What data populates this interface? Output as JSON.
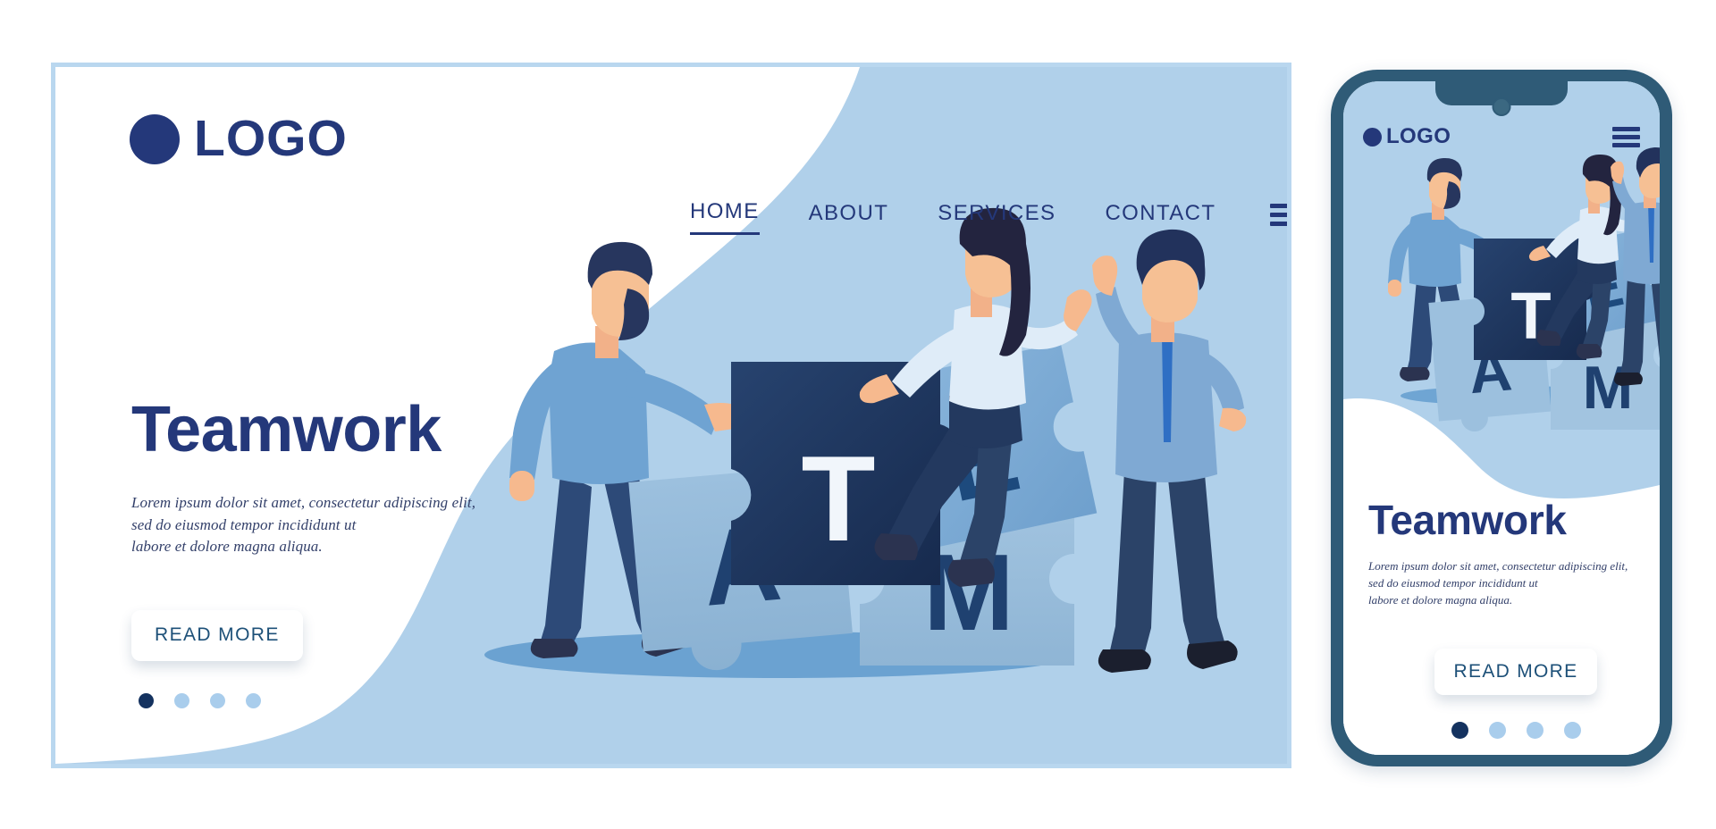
{
  "brand": {
    "logo_text": "LOGO",
    "logo_icon": "circle-dot-icon",
    "colors": {
      "navy": "#24387a",
      "deep_navy": "#14325f",
      "light_blue": "#b0d0ea",
      "pale_blue": "#b9d7ef",
      "dot_inactive": "#a9cdec",
      "phone_bezel": "#2f5b77",
      "button_text": "#1d5078",
      "white": "#ffffff"
    }
  },
  "desktop": {
    "nav": {
      "items": [
        {
          "label": "HOME",
          "active": true
        },
        {
          "label": "ABOUT",
          "active": false
        },
        {
          "label": "SERVICES",
          "active": false
        },
        {
          "label": "CONTACT",
          "active": false
        }
      ],
      "menu_icon": "hamburger-menu-icon"
    },
    "hero": {
      "title": "Teamwork",
      "paragraph": "Lorem ipsum dolor sit amet, consectetur adipiscing elit, sed do eiusmod tempor incididunt ut labore et dolore magna aliqua.",
      "paragraph_lines": [
        "Lorem ipsum dolor sit amet, consectetur adipiscing elit,",
        "sed do eiusmod tempor incididunt ut",
        "labore et dolore magna aliqua."
      ],
      "cta_label": "READ MORE",
      "carousel_dots": 4,
      "carousel_active_index": 0
    },
    "illustration": {
      "name": "teamwork-puzzle-illustration",
      "puzzle_letters": [
        "T",
        "E",
        "A",
        "M"
      ],
      "characters": [
        "bearded-man-holding-t-piece",
        "woman-sitting-on-puzzle",
        "man-with-necktie"
      ],
      "piece_colors": {
        "T": "#1e3a6b",
        "E": "#7faed8",
        "A": "#8fb8d8",
        "M": "#96bdd9"
      }
    }
  },
  "phone": {
    "logo_text": "LOGO",
    "menu_icon": "hamburger-menu-icon",
    "hero": {
      "title": "Teamwork",
      "paragraph_lines": [
        "Lorem ipsum dolor sit amet, consectetur adipiscing elit,",
        "sed do eiusmod tempor incididunt ut",
        "labore et dolore magna aliqua."
      ],
      "cta_label": "READ MORE",
      "carousel_dots": 4,
      "carousel_active_index": 0
    },
    "illustration": {
      "name": "teamwork-puzzle-illustration-mobile",
      "puzzle_letters": [
        "T",
        "E",
        "A",
        "M"
      ]
    }
  }
}
